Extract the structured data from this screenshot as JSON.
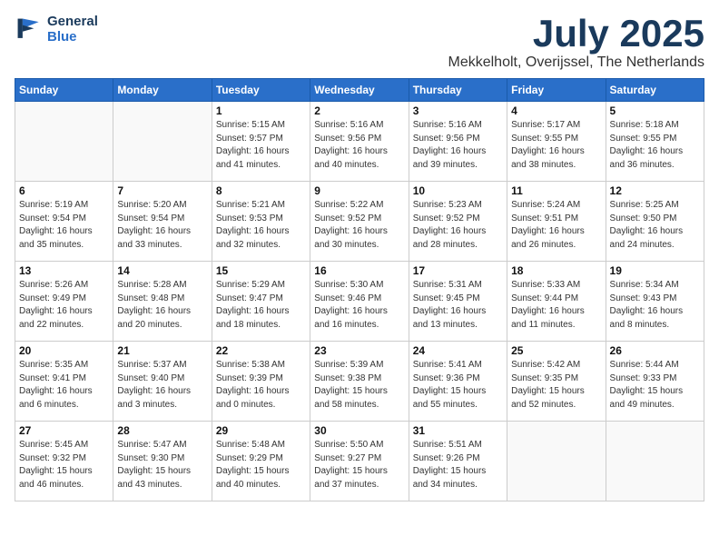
{
  "header": {
    "logo_line1": "General",
    "logo_line2": "Blue",
    "month": "July 2025",
    "location": "Mekkelholt, Overijssel, The Netherlands"
  },
  "days_of_week": [
    "Sunday",
    "Monday",
    "Tuesday",
    "Wednesday",
    "Thursday",
    "Friday",
    "Saturday"
  ],
  "weeks": [
    [
      {
        "num": "",
        "info": ""
      },
      {
        "num": "",
        "info": ""
      },
      {
        "num": "1",
        "info": "Sunrise: 5:15 AM\nSunset: 9:57 PM\nDaylight: 16 hours\nand 41 minutes."
      },
      {
        "num": "2",
        "info": "Sunrise: 5:16 AM\nSunset: 9:56 PM\nDaylight: 16 hours\nand 40 minutes."
      },
      {
        "num": "3",
        "info": "Sunrise: 5:16 AM\nSunset: 9:56 PM\nDaylight: 16 hours\nand 39 minutes."
      },
      {
        "num": "4",
        "info": "Sunrise: 5:17 AM\nSunset: 9:55 PM\nDaylight: 16 hours\nand 38 minutes."
      },
      {
        "num": "5",
        "info": "Sunrise: 5:18 AM\nSunset: 9:55 PM\nDaylight: 16 hours\nand 36 minutes."
      }
    ],
    [
      {
        "num": "6",
        "info": "Sunrise: 5:19 AM\nSunset: 9:54 PM\nDaylight: 16 hours\nand 35 minutes."
      },
      {
        "num": "7",
        "info": "Sunrise: 5:20 AM\nSunset: 9:54 PM\nDaylight: 16 hours\nand 33 minutes."
      },
      {
        "num": "8",
        "info": "Sunrise: 5:21 AM\nSunset: 9:53 PM\nDaylight: 16 hours\nand 32 minutes."
      },
      {
        "num": "9",
        "info": "Sunrise: 5:22 AM\nSunset: 9:52 PM\nDaylight: 16 hours\nand 30 minutes."
      },
      {
        "num": "10",
        "info": "Sunrise: 5:23 AM\nSunset: 9:52 PM\nDaylight: 16 hours\nand 28 minutes."
      },
      {
        "num": "11",
        "info": "Sunrise: 5:24 AM\nSunset: 9:51 PM\nDaylight: 16 hours\nand 26 minutes."
      },
      {
        "num": "12",
        "info": "Sunrise: 5:25 AM\nSunset: 9:50 PM\nDaylight: 16 hours\nand 24 minutes."
      }
    ],
    [
      {
        "num": "13",
        "info": "Sunrise: 5:26 AM\nSunset: 9:49 PM\nDaylight: 16 hours\nand 22 minutes."
      },
      {
        "num": "14",
        "info": "Sunrise: 5:28 AM\nSunset: 9:48 PM\nDaylight: 16 hours\nand 20 minutes."
      },
      {
        "num": "15",
        "info": "Sunrise: 5:29 AM\nSunset: 9:47 PM\nDaylight: 16 hours\nand 18 minutes."
      },
      {
        "num": "16",
        "info": "Sunrise: 5:30 AM\nSunset: 9:46 PM\nDaylight: 16 hours\nand 16 minutes."
      },
      {
        "num": "17",
        "info": "Sunrise: 5:31 AM\nSunset: 9:45 PM\nDaylight: 16 hours\nand 13 minutes."
      },
      {
        "num": "18",
        "info": "Sunrise: 5:33 AM\nSunset: 9:44 PM\nDaylight: 16 hours\nand 11 minutes."
      },
      {
        "num": "19",
        "info": "Sunrise: 5:34 AM\nSunset: 9:43 PM\nDaylight: 16 hours\nand 8 minutes."
      }
    ],
    [
      {
        "num": "20",
        "info": "Sunrise: 5:35 AM\nSunset: 9:41 PM\nDaylight: 16 hours\nand 6 minutes."
      },
      {
        "num": "21",
        "info": "Sunrise: 5:37 AM\nSunset: 9:40 PM\nDaylight: 16 hours\nand 3 minutes."
      },
      {
        "num": "22",
        "info": "Sunrise: 5:38 AM\nSunset: 9:39 PM\nDaylight: 16 hours\nand 0 minutes."
      },
      {
        "num": "23",
        "info": "Sunrise: 5:39 AM\nSunset: 9:38 PM\nDaylight: 15 hours\nand 58 minutes."
      },
      {
        "num": "24",
        "info": "Sunrise: 5:41 AM\nSunset: 9:36 PM\nDaylight: 15 hours\nand 55 minutes."
      },
      {
        "num": "25",
        "info": "Sunrise: 5:42 AM\nSunset: 9:35 PM\nDaylight: 15 hours\nand 52 minutes."
      },
      {
        "num": "26",
        "info": "Sunrise: 5:44 AM\nSunset: 9:33 PM\nDaylight: 15 hours\nand 49 minutes."
      }
    ],
    [
      {
        "num": "27",
        "info": "Sunrise: 5:45 AM\nSunset: 9:32 PM\nDaylight: 15 hours\nand 46 minutes."
      },
      {
        "num": "28",
        "info": "Sunrise: 5:47 AM\nSunset: 9:30 PM\nDaylight: 15 hours\nand 43 minutes."
      },
      {
        "num": "29",
        "info": "Sunrise: 5:48 AM\nSunset: 9:29 PM\nDaylight: 15 hours\nand 40 minutes."
      },
      {
        "num": "30",
        "info": "Sunrise: 5:50 AM\nSunset: 9:27 PM\nDaylight: 15 hours\nand 37 minutes."
      },
      {
        "num": "31",
        "info": "Sunrise: 5:51 AM\nSunset: 9:26 PM\nDaylight: 15 hours\nand 34 minutes."
      },
      {
        "num": "",
        "info": ""
      },
      {
        "num": "",
        "info": ""
      }
    ]
  ]
}
